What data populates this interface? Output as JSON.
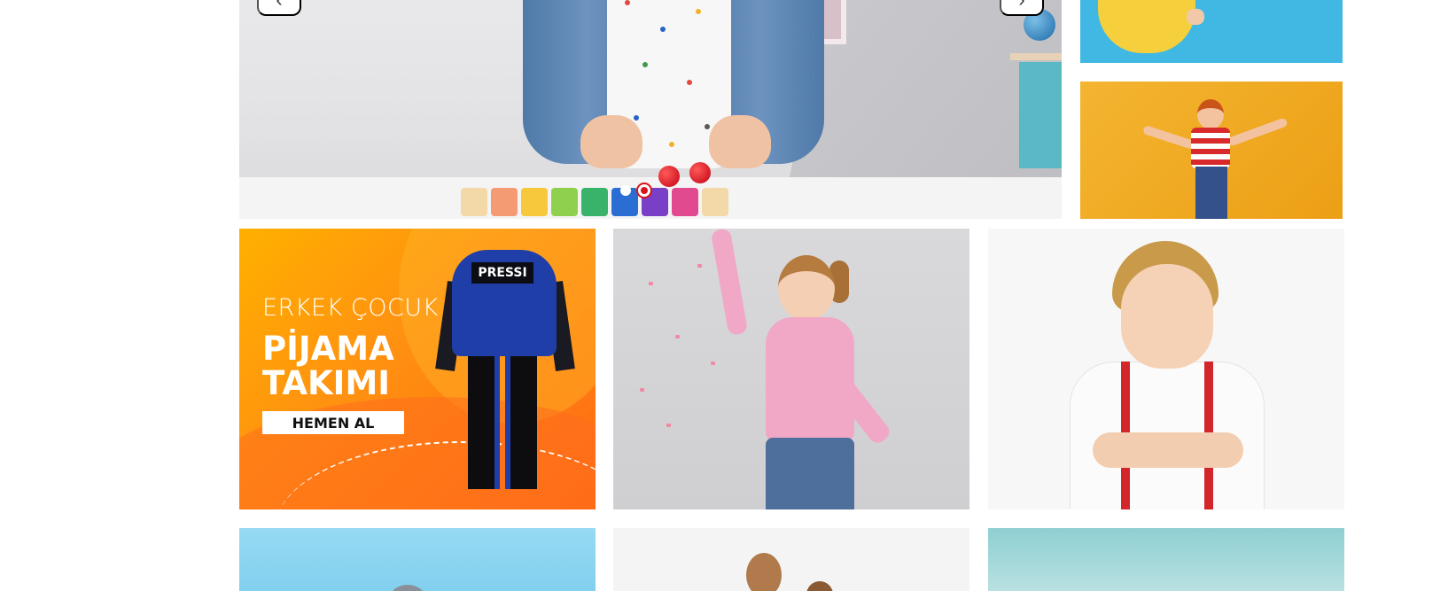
{
  "hero_slider": {
    "prev_label": "‹",
    "next_label": "›",
    "dots": [
      {
        "state": "inactive"
      },
      {
        "state": "active"
      }
    ]
  },
  "promo_banner": {
    "subtitle": "ERKEK ÇOCUK",
    "title": "PİJAMA TAKIMI",
    "button_label": "HEMEN AL",
    "product_print": "PRESSI"
  },
  "colors": {
    "accent_red": "#d8151a",
    "promo_orange": "#ff8f11",
    "promo_yellow": "#ffb000"
  },
  "icons": [
    "chevron-left-icon",
    "chevron-right-icon"
  ]
}
